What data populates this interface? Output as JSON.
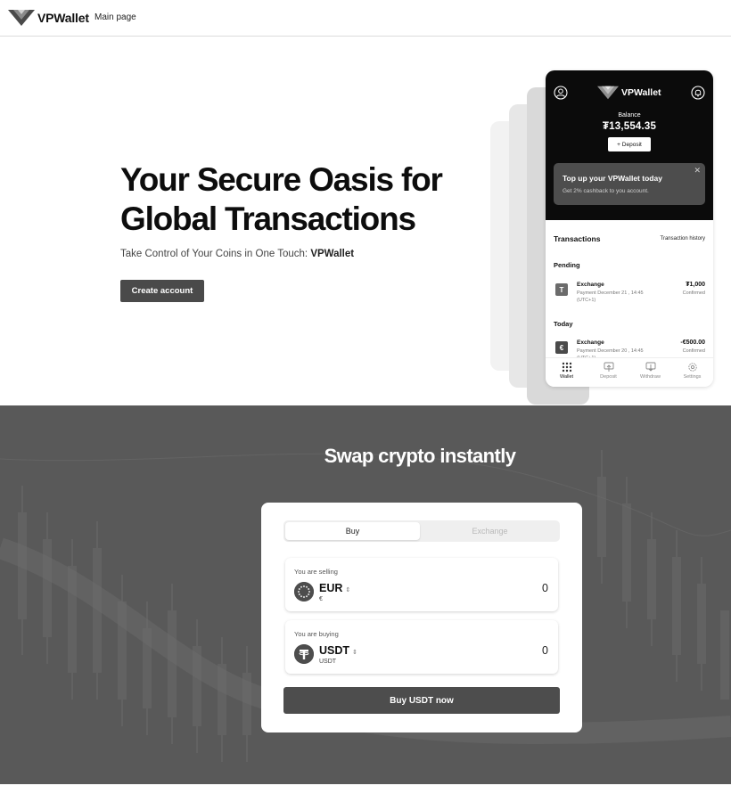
{
  "nav": {
    "brand": "VPWallet",
    "main_link": "Main page"
  },
  "hero": {
    "title": "Your Secure Oasis for Global Transactions",
    "subtitle_prefix": "Take Control of Your Coins in One Touch: ",
    "subtitle_brand": "VPWallet",
    "cta_label": "Create account"
  },
  "phone": {
    "brand": "VPWallet",
    "balance_label": "Balance",
    "balance_value": "₮13,554.35",
    "deposit_label": "+ Deposit",
    "banner": {
      "title": "Top up your VPWallet today",
      "subtitle": "Get 2% cashback to you account.",
      "close": "✕"
    },
    "transactions_title": "Transactions",
    "history_link": "Transaction history",
    "sections": [
      {
        "label": "Pending"
      },
      {
        "label": "Today"
      }
    ],
    "rows": [
      {
        "icon": "T",
        "title": "Exchange",
        "meta": "Payment December 21 , 14:45 (UTC+1)",
        "amount": "₮1,000",
        "status": "Confirmed"
      },
      {
        "icon": "€",
        "title": "Exchange",
        "meta": "Payment December 20 , 14:45 (UTC+1)",
        "amount": "-€500.00",
        "status": "Confirmed"
      }
    ],
    "bottom_nav": [
      {
        "label": "Wallet",
        "icon": "grid-icon"
      },
      {
        "label": "Deposit",
        "icon": "upload-icon"
      },
      {
        "label": "Withdraw",
        "icon": "download-icon"
      },
      {
        "label": "Settings",
        "icon": "gear-icon"
      }
    ]
  },
  "swap": {
    "title": "Swap crypto instantly",
    "tabs": [
      "Buy",
      "Exchange"
    ],
    "selling": {
      "label": "You are selling",
      "code": "EUR",
      "sub": "€",
      "value": "0",
      "icon": "euro-stars-icon"
    },
    "buying": {
      "label": "You are buying",
      "code": "USDT",
      "sub": "USDT",
      "value": "0",
      "icon": "tether-icon"
    },
    "cta_label": "Buy USDT now"
  },
  "colors": {
    "dark": "#0b0b0b",
    "button": "#4a4a4a",
    "swap_bg": "#595959",
    "accent_banner": "#4d4d4d"
  }
}
